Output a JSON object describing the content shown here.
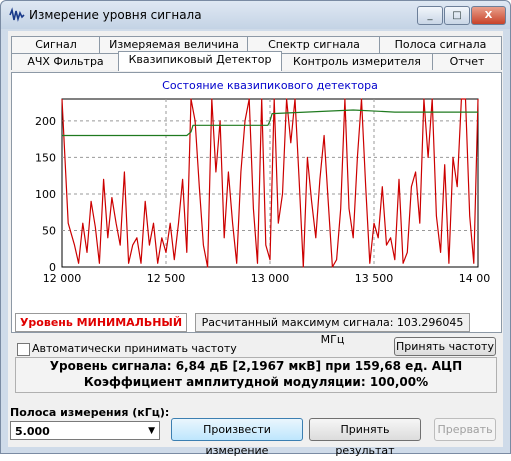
{
  "window": {
    "title": "Измерение уровня сигнала"
  },
  "title_buttons": {
    "minimize": "_",
    "maximize": "□",
    "close": "X"
  },
  "tabs_row1": [
    "Сигнал",
    "Измеряемая величина",
    "Спектр сигнала",
    "Полоса сигнала"
  ],
  "tabs_row2": [
    "АЧХ Фильтра",
    "Квазипиковый Детектор",
    "Контроль измерителя",
    "Отчет"
  ],
  "active_tab": "Квазипиковый Детектор",
  "chart_data": {
    "type": "line",
    "title": "Состояние квазипикового детектора",
    "xlim": [
      12000,
      14000
    ],
    "ylim": [
      0,
      230
    ],
    "x_ticks": [
      12000,
      12500,
      13000,
      13500,
      14000
    ],
    "x_tick_labels": [
      "12 000",
      "12 500",
      "13 000",
      "13 500",
      "14 000"
    ],
    "y_ticks": [
      0,
      50,
      100,
      150,
      200
    ],
    "y_tick_labels": [
      "0",
      "50",
      "100",
      "150",
      "200"
    ],
    "grid": true,
    "series": [
      {
        "color": "#cc0000",
        "x": [
          12000,
          12030,
          12060,
          12080,
          12100,
          12120,
          12140,
          12160,
          12180,
          12200,
          12220,
          12240,
          12260,
          12280,
          12300,
          12320,
          12340,
          12360,
          12380,
          12400,
          12420,
          12440,
          12460,
          12480,
          12500,
          12520,
          12540,
          12560,
          12580,
          12600,
          12620,
          12640,
          12660,
          12680,
          12700,
          12720,
          12740,
          12760,
          12780,
          12800,
          12820,
          12840,
          12860,
          12880,
          12900,
          12920,
          12940,
          12960,
          12980,
          13000,
          13020,
          13040,
          13060,
          13080,
          13100,
          13120,
          13140,
          13160,
          13180,
          13200,
          13220,
          13240,
          13260,
          13280,
          13300,
          13320,
          13340,
          13360,
          13380,
          13400,
          13420,
          13440,
          13460,
          13480,
          13500,
          13520,
          13540,
          13560,
          13580,
          13600,
          13620,
          13640,
          13660,
          13680,
          13700,
          13720,
          13740,
          13760,
          13780,
          13800,
          13820,
          13840,
          13860,
          13880,
          13900,
          13920,
          13940,
          13960,
          13980,
          14000
        ],
        "y": [
          230,
          60,
          30,
          5,
          60,
          20,
          90,
          55,
          5,
          120,
          40,
          95,
          60,
          30,
          130,
          5,
          30,
          40,
          5,
          90,
          30,
          60,
          5,
          40,
          20,
          60,
          10,
          60,
          120,
          20,
          230,
          200,
          110,
          30,
          0,
          230,
          130,
          200,
          40,
          130,
          60,
          5,
          130,
          200,
          230,
          80,
          5,
          230,
          30,
          10,
          230,
          60,
          100,
          230,
          170,
          230,
          120,
          0,
          150,
          90,
          40,
          120,
          180,
          90,
          0,
          10,
          80,
          230,
          80,
          40,
          150,
          230,
          110,
          5,
          60,
          40,
          110,
          30,
          40,
          10,
          120,
          5,
          20,
          110,
          130,
          60,
          230,
          150,
          230,
          70,
          20,
          140,
          5,
          150,
          110,
          230,
          230,
          70,
          5,
          230
        ]
      },
      {
        "color": "#1f7a1f",
        "x": [
          12000,
          12300,
          12600,
          12620,
          12630,
          12800,
          12990,
          13000,
          13010,
          13400,
          13600,
          14000
        ],
        "y": [
          180,
          180,
          180,
          185,
          194,
          194,
          194,
          200,
          210,
          215,
          212,
          212
        ]
      }
    ]
  },
  "status": {
    "level_label": "Уровень МИНИМАЛЬНЫЙ",
    "max_freq_text": "Расчитанный максимум сигнала: 103.296045 МГц"
  },
  "options": {
    "auto_accept_label": "Автоматически принимать частоту",
    "accept_freq_button": "Принять частоту"
  },
  "result": {
    "line1": "Уровень сигнала: 6,84 дБ [2,1967 мкВ] при 159,68 ед. АЦП",
    "line2": "Коэффициент амплитудной модуляции: 100,00%"
  },
  "bandwidth": {
    "label": "Полоса измерения (кГц):",
    "value": "5.000"
  },
  "actions": {
    "measure_button": "Произвести измерение",
    "accept_button": "Принять результат",
    "stop_button": "Прервать"
  },
  "colors": {
    "status_text": "#e00000",
    "curve": "#cc0000",
    "envelope": "#1f7a1f",
    "title_text": "#0000cc"
  }
}
